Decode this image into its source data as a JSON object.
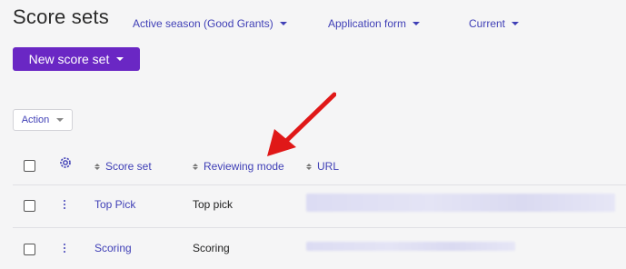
{
  "page": {
    "title": "Score sets"
  },
  "filters": [
    {
      "label": "Active season (Good Grants)"
    },
    {
      "label": "Application form"
    },
    {
      "label": "Current"
    }
  ],
  "toolbar": {
    "new_label": "New score set",
    "action_label": "Action"
  },
  "table": {
    "columns": [
      "Score set",
      "Reviewing mode",
      "URL"
    ],
    "rows": [
      {
        "score_set": "Top Pick",
        "reviewing_mode": "Top pick",
        "url": ""
      },
      {
        "score_set": "Scoring",
        "reviewing_mode": "Scoring",
        "url": ""
      }
    ]
  },
  "colors": {
    "accent": "#6a27c4",
    "link": "#3f3fb6",
    "annotation_arrow": "#e01818"
  },
  "icons": {
    "column_settings": "gear-icon",
    "row_menu": "kebab-icon",
    "sort": "sort-icon"
  }
}
